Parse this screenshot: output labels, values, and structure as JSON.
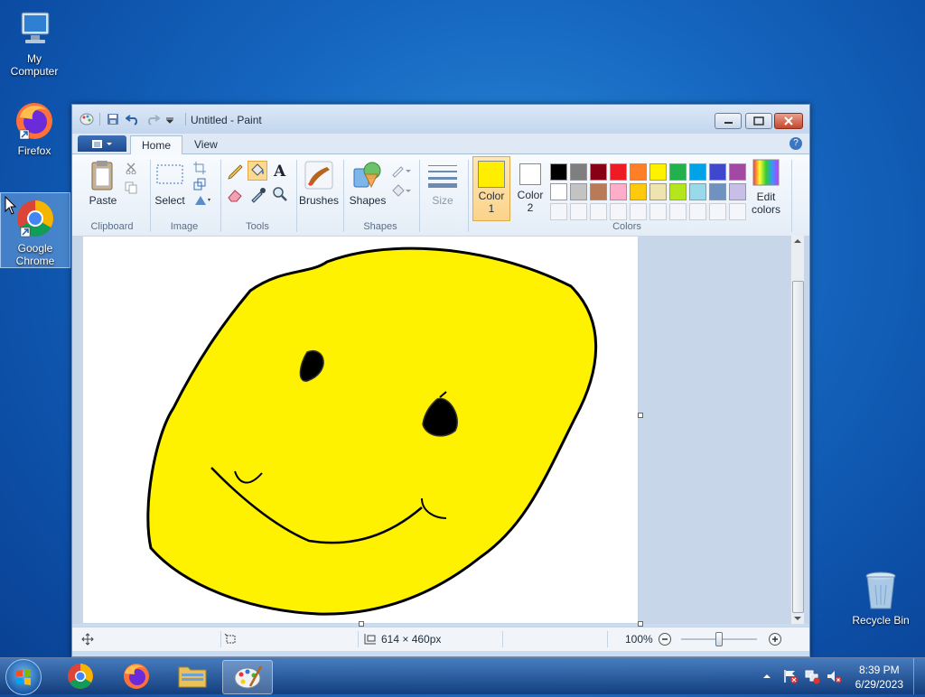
{
  "desktop": {
    "icons": [
      {
        "label": "My Computer"
      },
      {
        "label": "Firefox"
      },
      {
        "label": "Google Chrome"
      },
      {
        "label": "Recycle Bin"
      }
    ]
  },
  "window": {
    "title": "Untitled - Paint",
    "tabs": [
      {
        "label": "Home"
      },
      {
        "label": "View"
      }
    ],
    "help": "?"
  },
  "ribbon": {
    "clipboard": {
      "label": "Clipboard",
      "paste": "Paste"
    },
    "image": {
      "label": "Image",
      "select": "Select"
    },
    "tools": {
      "label": "Tools"
    },
    "brushes": "Brushes",
    "shapes": {
      "label": "Shapes",
      "button": "Shapes"
    },
    "size": "Size",
    "color1": {
      "line1": "Color",
      "line2": "1",
      "value": "#ffee00"
    },
    "color2": {
      "line1": "Color",
      "line2": "2",
      "value": "#ffffff"
    },
    "colors_label": "Colors",
    "edit_colors": {
      "line1": "Edit",
      "line2": "colors"
    },
    "palette_row1": [
      "#000000",
      "#7f7f7f",
      "#880015",
      "#ed1c24",
      "#ff7f27",
      "#fff200",
      "#22b14c",
      "#00a2e8",
      "#3f48cc",
      "#a349a4"
    ],
    "palette_row2": [
      "#ffffff",
      "#c3c3c3",
      "#b97a57",
      "#ffaec9",
      "#ffc90e",
      "#efe4b0",
      "#b5e61d",
      "#99d9ea",
      "#7092be",
      "#c8bfe7"
    ]
  },
  "statusbar": {
    "dimensions": "614 × 460px",
    "zoom": "100%"
  },
  "taskbar": {
    "time": "8:39 PM",
    "date": "6/29/2023"
  }
}
